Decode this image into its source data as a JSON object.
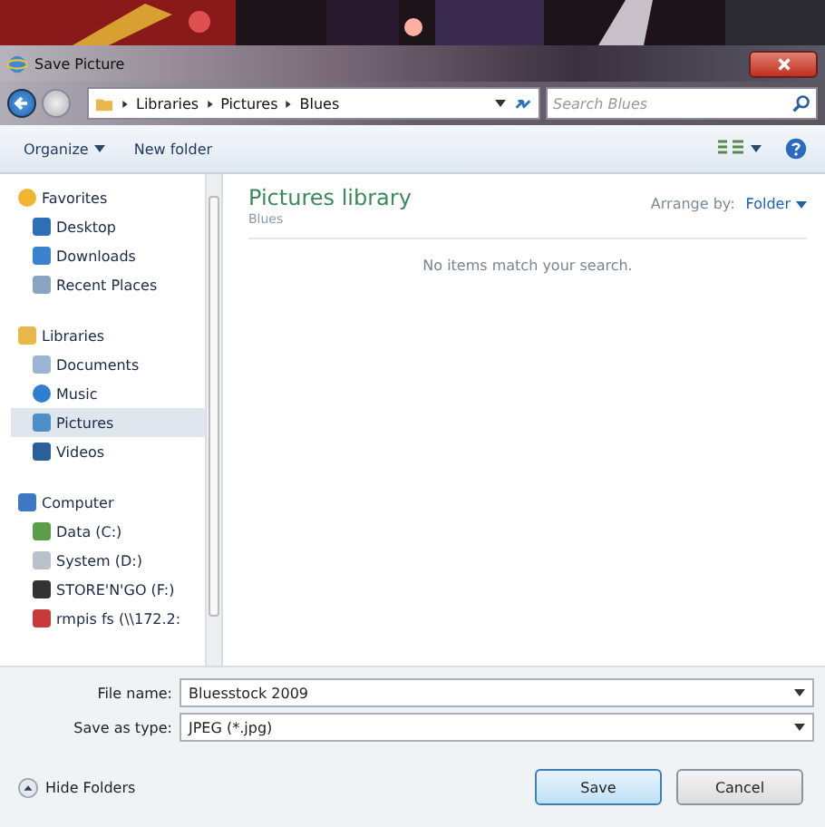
{
  "window": {
    "title": "Save Picture"
  },
  "address": {
    "crumbs": [
      "Libraries",
      "Pictures",
      "Blues"
    ],
    "search_placeholder": "Search Blues"
  },
  "toolbar": {
    "organize": "Organize",
    "new_folder": "New folder"
  },
  "sidebar": {
    "groups": [
      {
        "label": "Favorites",
        "kind": "star",
        "children": [
          {
            "label": "Desktop",
            "kind": "desktop",
            "selected": false
          },
          {
            "label": "Downloads",
            "kind": "download",
            "selected": false
          },
          {
            "label": "Recent Places",
            "kind": "recent",
            "selected": false
          }
        ]
      },
      {
        "label": "Libraries",
        "kind": "library",
        "children": [
          {
            "label": "Documents",
            "kind": "document",
            "selected": false
          },
          {
            "label": "Music",
            "kind": "music",
            "selected": false
          },
          {
            "label": "Pictures",
            "kind": "pictures",
            "selected": true
          },
          {
            "label": "Videos",
            "kind": "video",
            "selected": false
          }
        ]
      },
      {
        "label": "Computer",
        "kind": "computer",
        "children": [
          {
            "label": "Data (C:)",
            "kind": "osdrive",
            "selected": false
          },
          {
            "label": "System (D:)",
            "kind": "drive",
            "selected": false
          },
          {
            "label": "STORE'N'GO (F:)",
            "kind": "usb",
            "selected": false
          },
          {
            "label": "rmpis fs (\\\\172.2:",
            "kind": "netdrive",
            "selected": false
          }
        ]
      }
    ]
  },
  "library": {
    "title": "Pictures library",
    "subtitle": "Blues",
    "arrange_label": "Arrange by:",
    "arrange_value": "Folder",
    "empty_message": "No items match your search."
  },
  "form": {
    "file_name_label": "File name:",
    "file_name": "Bluesstock 2009",
    "type_label": "Save as type:",
    "type": "JPEG (*.jpg)"
  },
  "footer": {
    "hide_folders": "Hide Folders",
    "buttons": [
      {
        "label": "Save",
        "kind": "primary"
      },
      {
        "label": "Cancel",
        "kind": "normal"
      }
    ]
  }
}
